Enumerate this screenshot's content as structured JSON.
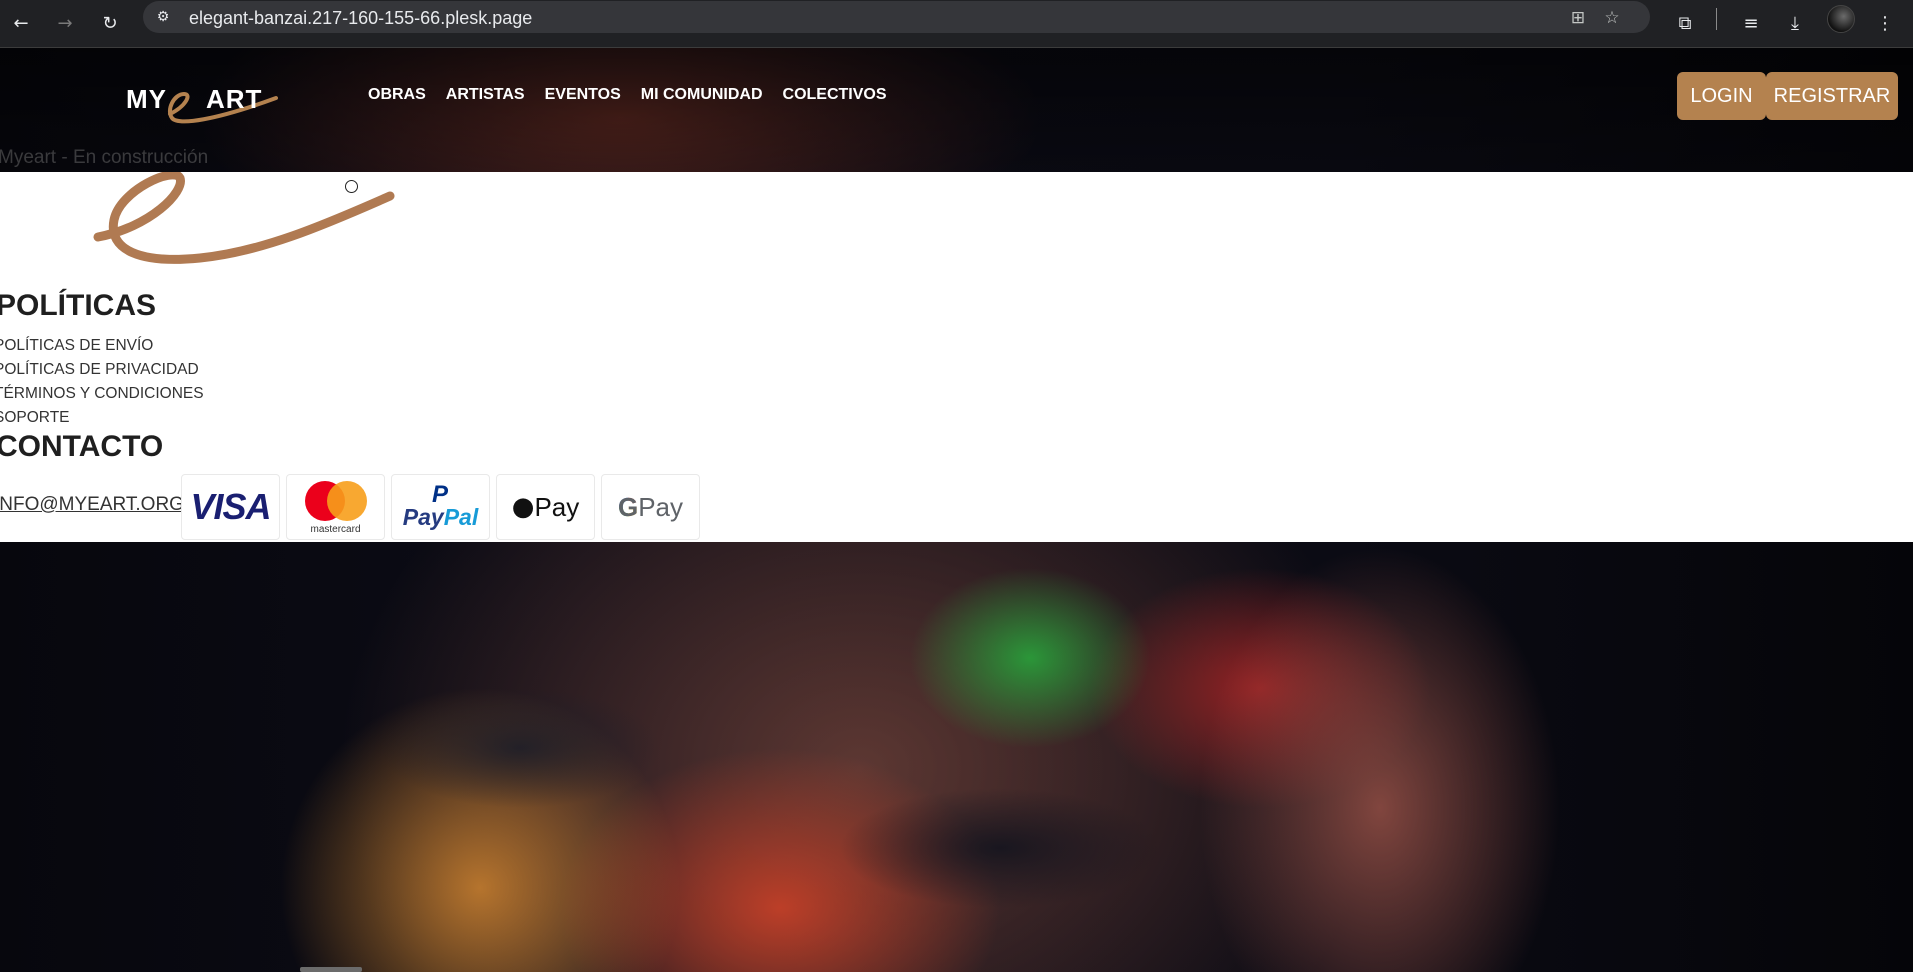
{
  "browser": {
    "url": "elegant-banzai.217-160-155-66.plesk.page",
    "back_icon": "←",
    "forward_icon": "→",
    "reload_icon": "↻",
    "site_info_icon": "⚙",
    "translate_icon": "⊞",
    "bookmark_icon": "☆",
    "extensions_icon": "⧉",
    "media_icon": "≡",
    "download_icon": "⤓",
    "menu_icon": "⋮"
  },
  "header": {
    "logo_my": "MY",
    "logo_art": "ART",
    "nav": [
      "OBRAS",
      "ARTISTAS",
      "EVENTOS",
      "MI COMUNIDAD",
      "COLECTIVOS"
    ],
    "login_label": "LOGIN",
    "register_label": "REGISTRAR"
  },
  "image_alt": "Myeart - En construcción",
  "footer": {
    "politicas_title": "POLÍTICAS",
    "policy_links": [
      "POLÍTICAS DE ENVÍO",
      "POLÍTICAS DE PRIVACIDAD",
      "TÉRMINOS Y CONDICIONES",
      "SOPORTE"
    ],
    "contacto_title": "CONTACTO",
    "email": "INFO@MYEART.ORG",
    "payments": {
      "visa": "VISA",
      "mastercard": "mastercard",
      "paypal_pay": "Pay",
      "paypal_pal": "Pal",
      "apple_pay": " Pay",
      "google_pay": "Pay"
    }
  },
  "colors": {
    "accent": "#b4824f"
  }
}
